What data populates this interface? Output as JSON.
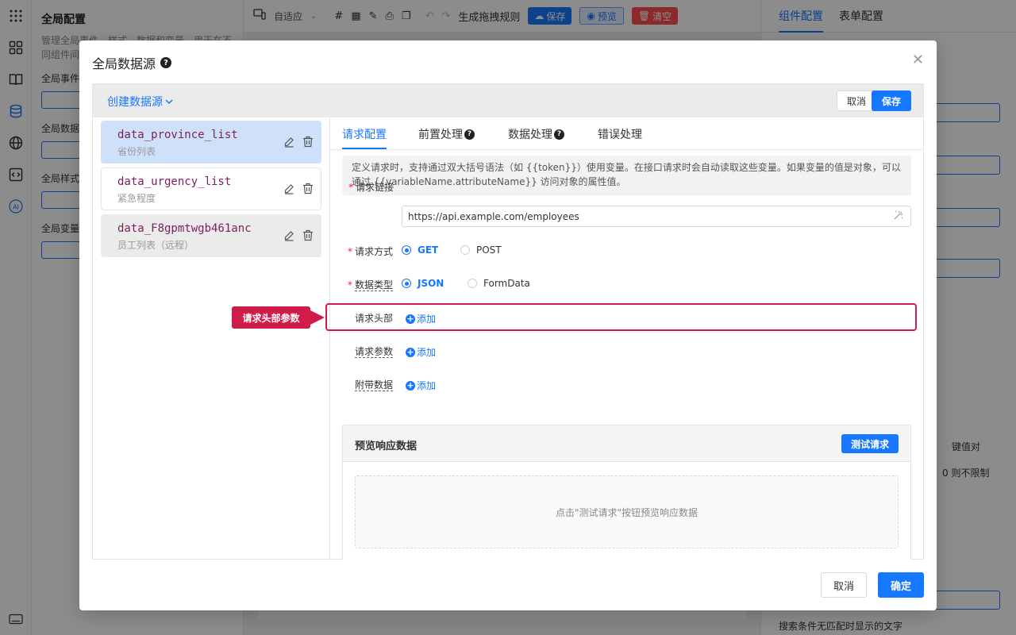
{
  "background": {
    "left_panel": {
      "title": "全局配置",
      "description": "管理全局事件、样式、数据和变量，用于在不同组件间",
      "sections": [
        "全局事件",
        "全局数据",
        "全局样式",
        "全局变量"
      ]
    },
    "toolbar": {
      "adapt_label": "自适应",
      "generate_rules": "生成拖拽规则",
      "save": "保存",
      "preview": "预览",
      "clear": "清空"
    },
    "right_panel": {
      "tabs": [
        "组件配置",
        "表单配置"
      ],
      "key_value": "键值对",
      "limit_text": "0 则不限制",
      "no_match_text": "搜索条件无匹配时显示的文字"
    }
  },
  "modal": {
    "title": "全局数据源",
    "create_label": "创建数据源",
    "head_cancel": "取消",
    "head_save": "保存",
    "datasources": [
      {
        "name": "data_province_list",
        "desc": "省份列表"
      },
      {
        "name": "data_urgency_list",
        "desc": "紧急程度"
      },
      {
        "name": "data_F8gpmtwgb461anc",
        "desc": "员工列表（远程）"
      }
    ],
    "tabs": [
      "请求配置",
      "前置处理",
      "数据处理",
      "错误处理"
    ],
    "info_text": "定义请求时，支持通过双大括号语法（如 {{token}}）使用变量。在接口请求时会自动读取这些变量。如果变量的值是对象，可以通过 {{variableName.attributeName}} 访问对象的属性值。",
    "fields": {
      "url_label": "请求链接",
      "url_value": "https://api.example.com/employees",
      "method_label": "请求方式",
      "method_get": "GET",
      "method_post": "POST",
      "datatype_label": "数据类型",
      "datatype_json": "JSON",
      "datatype_form": "FormData",
      "headers_label": "请求头部",
      "params_label": "请求参数",
      "extra_label": "附带数据",
      "add": "添加"
    },
    "preview": {
      "title": "预览响应数据",
      "test_button": "测试请求",
      "placeholder": "点击\"测试请求\"按钮预览响应数据"
    },
    "footer_cancel": "取消",
    "footer_ok": "确定"
  },
  "annotation": {
    "callout": "请求头部参数",
    "color": "#d01c4b"
  },
  "accent_color": "#1677ff"
}
